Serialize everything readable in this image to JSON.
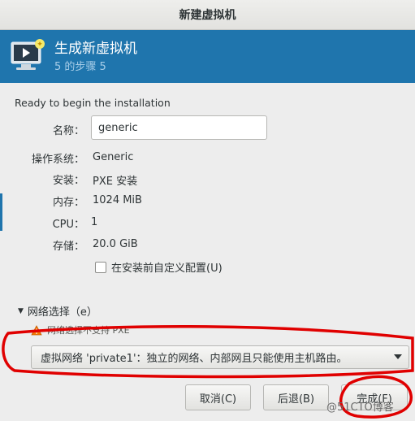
{
  "window": {
    "title": "新建虚拟机"
  },
  "banner": {
    "title": "生成新虚拟机",
    "step": "5 的步骤 5"
  },
  "ready_text": "Ready to begin the installation",
  "fields": {
    "name_label": "名称：",
    "name_value": "generic",
    "os_label": "操作系统：",
    "os_value": "Generic",
    "install_label": "安装：",
    "install_value": "PXE 安装",
    "memory_label": "内存：",
    "memory_value": "1024 MiB",
    "cpu_label": "CPU：",
    "cpu_value": "1",
    "storage_label": "存储：",
    "storage_value": "20.0 GiB"
  },
  "customize_checkbox": {
    "label": "在安装前自定义配置(U)",
    "checked": false
  },
  "network": {
    "section_label": "网络选择（e）",
    "warning": "网络选择不支持 PXE",
    "selected": "虚拟网络 'private1'：独立的网络、内部网且只能使用主机路由。"
  },
  "buttons": {
    "cancel": "取消(C)",
    "back": "后退(B)",
    "finish": "完成(F)"
  },
  "watermark": "@51CTO博客",
  "colors": {
    "banner": "#1f75ad",
    "annotation": "#e00000"
  },
  "icons": {
    "banner": "monitor-icon",
    "warning": "warning-icon",
    "expander": "triangle-down-icon",
    "combo": "dropdown-arrow-icon"
  }
}
